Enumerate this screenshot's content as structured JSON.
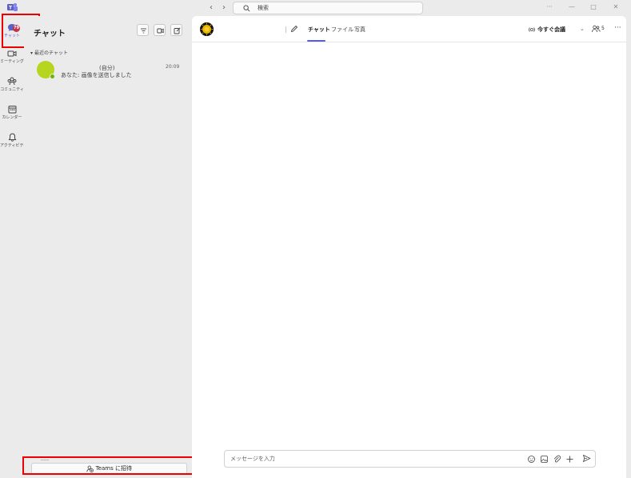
{
  "titlebar": {
    "search_placeholder": "検索",
    "minimize": "—",
    "maximize": "□",
    "close": "✕",
    "more": "···"
  },
  "rail": {
    "items": [
      {
        "label": "チャット",
        "badge": "79"
      },
      {
        "label": "ミーティング"
      },
      {
        "label": "コミュニティ"
      },
      {
        "label": "カレンダー"
      },
      {
        "label": "アクティビティ"
      }
    ]
  },
  "chat_list": {
    "title": "チャット",
    "section": "最近のチャット",
    "chats": [
      {
        "name": "(自分)",
        "time": "20:09",
        "preview": "あなた: 画像を送信しました"
      }
    ],
    "invite_label": "Teams に招待"
  },
  "main": {
    "tabs": [
      {
        "label": "チャット",
        "active": true
      },
      {
        "label": "ファイル"
      },
      {
        "label": "写真"
      }
    ],
    "meet_now": "今すぐ会議",
    "participants": "5",
    "more": "···",
    "composer_placeholder": "メッセージを入力"
  },
  "colors": {
    "accent": "#5b5fc7",
    "badge": "#c4314b",
    "highlight": "#e00000",
    "avatar": "#b5d51e"
  }
}
